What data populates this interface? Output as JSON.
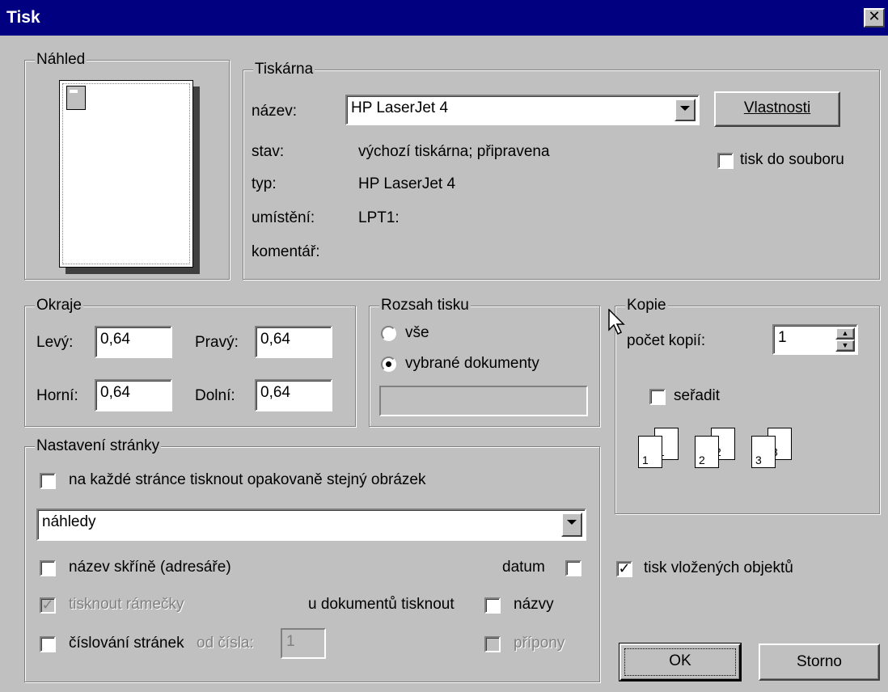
{
  "window": {
    "title": "Tisk"
  },
  "preview": {
    "legend": "Náhled"
  },
  "printer": {
    "legend": "Tiskárna",
    "name_label": "název:",
    "name_value": "HP LaserJet 4",
    "properties_button": "Vlastnosti",
    "print_to_file": {
      "label": "tisk do souboru",
      "checked": false
    },
    "status_label": "stav:",
    "status_value": "výchozí tiskárna; připravena",
    "type_label": "typ:",
    "type_value": "HP LaserJet 4",
    "location_label": "umístění:",
    "location_value": "LPT1:",
    "comment_label": "komentář:"
  },
  "margins": {
    "legend": "Okraje",
    "left_label": "Levý:",
    "left_value": "0,64",
    "right_label": "Pravý:",
    "right_value": "0,64",
    "top_label": "Horní:",
    "top_value": "0,64",
    "bottom_label": "Dolní:",
    "bottom_value": "0,64"
  },
  "range": {
    "legend": "Rozsah tisku",
    "all_label": "vše",
    "selected_label": "vybrané dokumenty",
    "selected": "vybrané dokumenty"
  },
  "copies": {
    "legend": "Kopie",
    "count_label": "počet kopií:",
    "count_value": "1",
    "collate_label": "seřadit",
    "collate_checked": false,
    "pages": [
      "1",
      "2",
      "3"
    ]
  },
  "page_setup": {
    "legend": "Nastavení stránky",
    "repeat_image_label": "na každé stránce tisknout opakovaně stejný obrázek",
    "layout_value": "náhledy",
    "cabinet_name_label": "název skříně (adresáře)",
    "date_label": "datum",
    "frames_label": "tisknout rámečky",
    "frames_checked": true,
    "documents_print_label": "u dokumentů tisknout",
    "names_label": "názvy",
    "page_numbering_label": "číslování stránek",
    "from_number_label": "od čísla:",
    "from_number_value": "1",
    "extensions_label": "přípony"
  },
  "embedded_objects": {
    "label": "tisk vložených objektů",
    "checked": true
  },
  "buttons": {
    "ok": "OK",
    "cancel": "Storno"
  },
  "icons": {
    "close": "close-icon",
    "cursor": "mouse-cursor-icon"
  }
}
